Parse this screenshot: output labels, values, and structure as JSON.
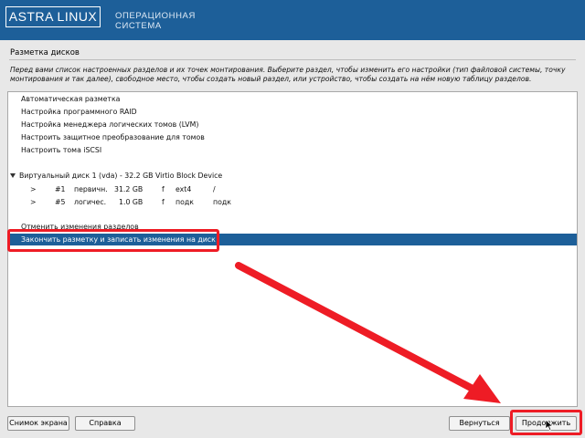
{
  "header": {
    "brand": "ASTRA LINUX",
    "subtitle_line1": "ОПЕРАЦИОННАЯ",
    "subtitle_line2": "СИСТЕМА",
    "background_color": "#1d5f99"
  },
  "page": {
    "title": "Разметка дисков",
    "instructions": "Перед вами список настроенных разделов и их точек монтирования. Выберите раздел, чтобы изменить его настройки (тип файловой системы, точку монтирования и так далее), свободное место, чтобы создать новый раздел, или устройство, чтобы создать на нём новую таблицу разделов."
  },
  "list": {
    "selected_color": "#1d5f99",
    "items": [
      {
        "label": "Автоматическая разметка"
      },
      {
        "label": "Настройка программного RAID"
      },
      {
        "label": "Настройка менеджера логических томов (LVM)"
      },
      {
        "label": "Настроить защитное преобразование для томов"
      },
      {
        "label": "Настроить тома iSCSI"
      }
    ],
    "disk": {
      "label": "Виртуальный диск 1 (vda) - 32.2 GB Virtio Block Device",
      "partitions": [
        {
          "arrow": ">",
          "number": "#1",
          "type": "первичн.",
          "size": "31.2 GB",
          "flag": "f",
          "fs": "ext4",
          "mount": "/"
        },
        {
          "arrow": ">",
          "number": "#5",
          "type": "логичес.",
          "size": "1.0 GB",
          "flag": "f",
          "fs": "подк",
          "mount": "подк"
        }
      ]
    },
    "undo": {
      "label": "Отменить изменения разделов"
    },
    "finish": {
      "label": "Закончить разметку и записать изменения на диск",
      "selected": true
    }
  },
  "buttons": {
    "screenshot": "Снимок экрана",
    "help": "Справка",
    "back": "Вернуться",
    "continue": "Продолжить"
  },
  "annotation": {
    "color": "#ee1c25"
  }
}
